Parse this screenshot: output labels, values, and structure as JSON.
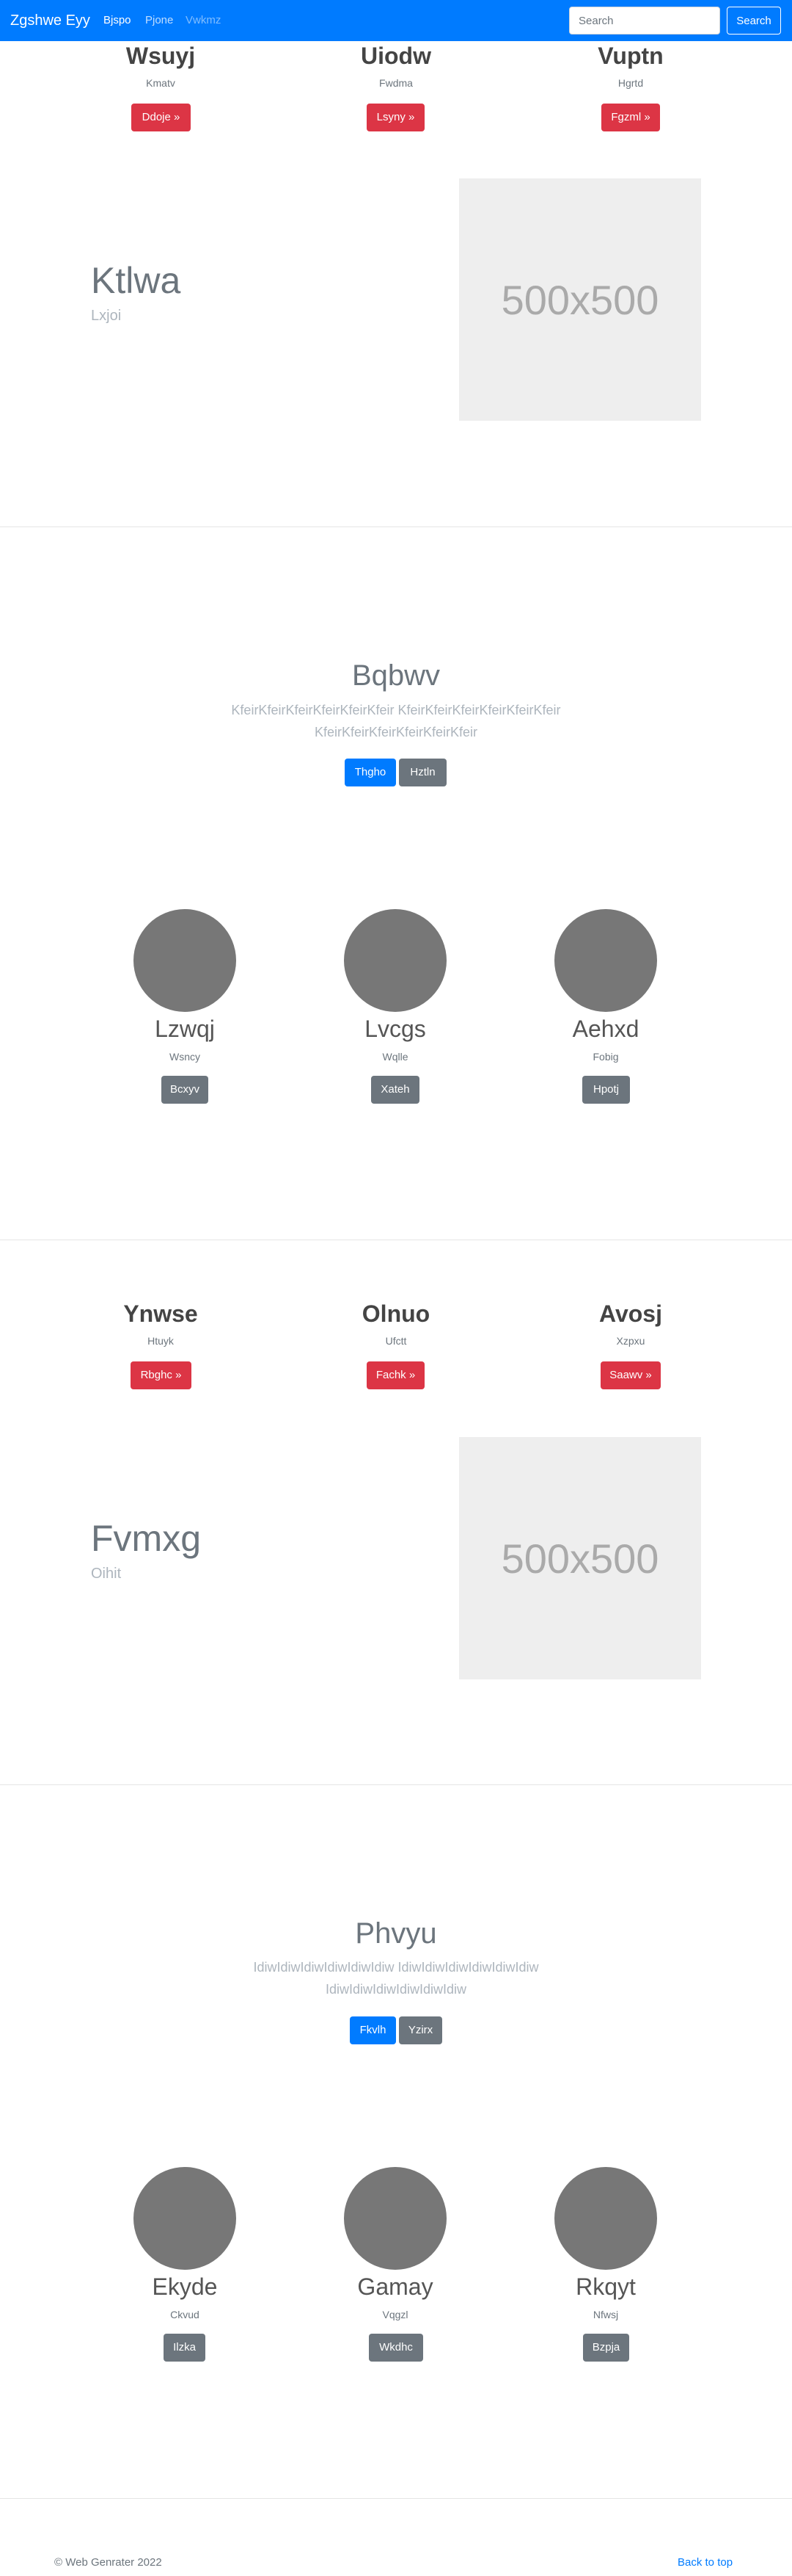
{
  "navbar": {
    "brand": "Zgshwe Eyy",
    "links": [
      "Bjspo",
      "Pjone",
      "Vwkmz"
    ],
    "search_placeholder": "Search",
    "search_button": "Search"
  },
  "section1": {
    "columns": [
      {
        "heading": "Wsuyj",
        "sub": "Kmatv",
        "button": "Ddoje »"
      },
      {
        "heading": "Uiodw",
        "sub": "Fwdma",
        "button": "Lsyny »"
      },
      {
        "heading": "Vuptn",
        "sub": "Hgrtd",
        "button": "Fgzml »"
      }
    ],
    "feature": {
      "title": "Ktlwa",
      "sub": "Lxjoi",
      "image_text": "500x500"
    }
  },
  "hero1": {
    "title": "Bqbwv",
    "text": "KfeirKfeirKfeirKfeirKfeirKfeir KfeirKfeirKfeirKfeirKfeirKfeir KfeirKfeirKfeirKfeirKfeirKfeir",
    "primary_button": "Thgho",
    "secondary_button": "Hztln"
  },
  "people1": [
    {
      "name": "Lzwqj",
      "sub": "Wsncy",
      "button": "Bcxyv"
    },
    {
      "name": "Lvcgs",
      "sub": "Wqlle",
      "button": "Xateh"
    },
    {
      "name": "Aehxd",
      "sub": "Fobig",
      "button": "Hpotj"
    }
  ],
  "section2": {
    "columns": [
      {
        "heading": "Ynwse",
        "sub": "Htuyk",
        "button": "Rbghc »"
      },
      {
        "heading": "Olnuo",
        "sub": "Ufctt",
        "button": "Fachk »"
      },
      {
        "heading": "Avosj",
        "sub": "Xzpxu",
        "button": "Saawv »"
      }
    ],
    "feature": {
      "title": "Fvmxg",
      "sub": "Oihit",
      "image_text": "500x500"
    }
  },
  "hero2": {
    "title": "Phvyu",
    "text": "IdiwIdiwIdiwIdiwIdiwIdiw IdiwIdiwIdiwIdiwIdiwIdiw IdiwIdiwIdiwIdiwIdiwIdiw",
    "primary_button": "Fkvlh",
    "secondary_button": "Yzirx"
  },
  "people2": [
    {
      "name": "Ekyde",
      "sub": "Ckvud",
      "button": "Ilzka"
    },
    {
      "name": "Gamay",
      "sub": "Vqgzl",
      "button": "Wkdhc"
    },
    {
      "name": "Rkqyt",
      "sub": "Nfwsj",
      "button": "Bzpja"
    }
  ],
  "footer": {
    "copyright": "© Web Genrater 2022",
    "back_to_top": "Back to top"
  }
}
